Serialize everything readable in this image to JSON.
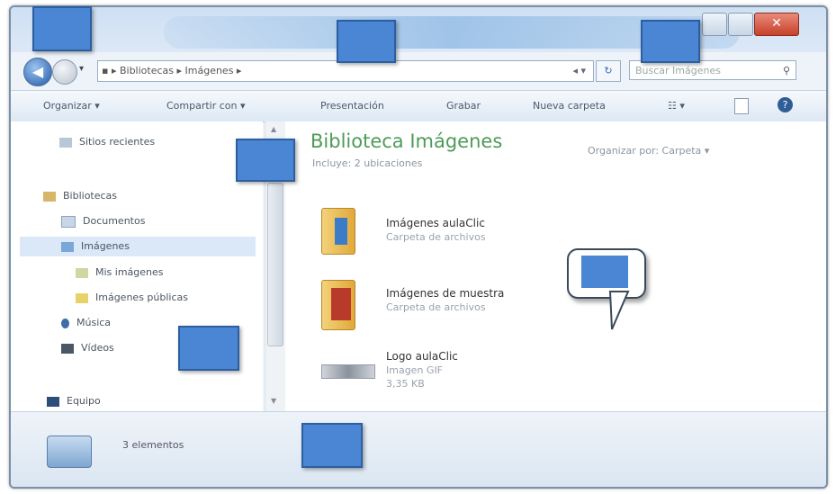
{
  "window": {
    "address_path": "▪ ▸ Bibliotecas ▸ Imágenes ▸",
    "address_arrows": "◂ ▾",
    "search_placeholder": "Buscar Imágenes",
    "close_glyph": "✕"
  },
  "toolbar": {
    "organize": "Organizar ▾",
    "share": "Compartir con ▾",
    "slideshow": "Presentación",
    "burn": "Grabar",
    "new_folder": "Nueva carpeta",
    "view_glyph": "☷ ▾",
    "help_glyph": "?"
  },
  "sidebar": {
    "recent": "Sitios recientes",
    "libraries": "Bibliotecas",
    "documents": "Documentos",
    "images": "Imágenes",
    "my_images": "Mis imágenes",
    "public_images": "Imágenes públicas",
    "music": "Música",
    "videos": "Vídeos",
    "computer": "Equipo"
  },
  "main": {
    "title": "Biblioteca Imágenes",
    "includes": "Incluye: 2 ubicaciones",
    "arrange_by": "Organizar por:  Carpeta ▾",
    "files": [
      {
        "name": "Imágenes aulaClic",
        "type": "Carpeta de archivos"
      },
      {
        "name": "Imágenes de muestra",
        "type": "Carpeta de archivos"
      },
      {
        "name": "Logo aulaClic",
        "type": "Imagen GIF",
        "size": "3,35 KB"
      }
    ]
  },
  "status": {
    "count": "3 elementos"
  },
  "colors": {
    "accent": "#4d9b58",
    "callout": "#4a86d3"
  }
}
